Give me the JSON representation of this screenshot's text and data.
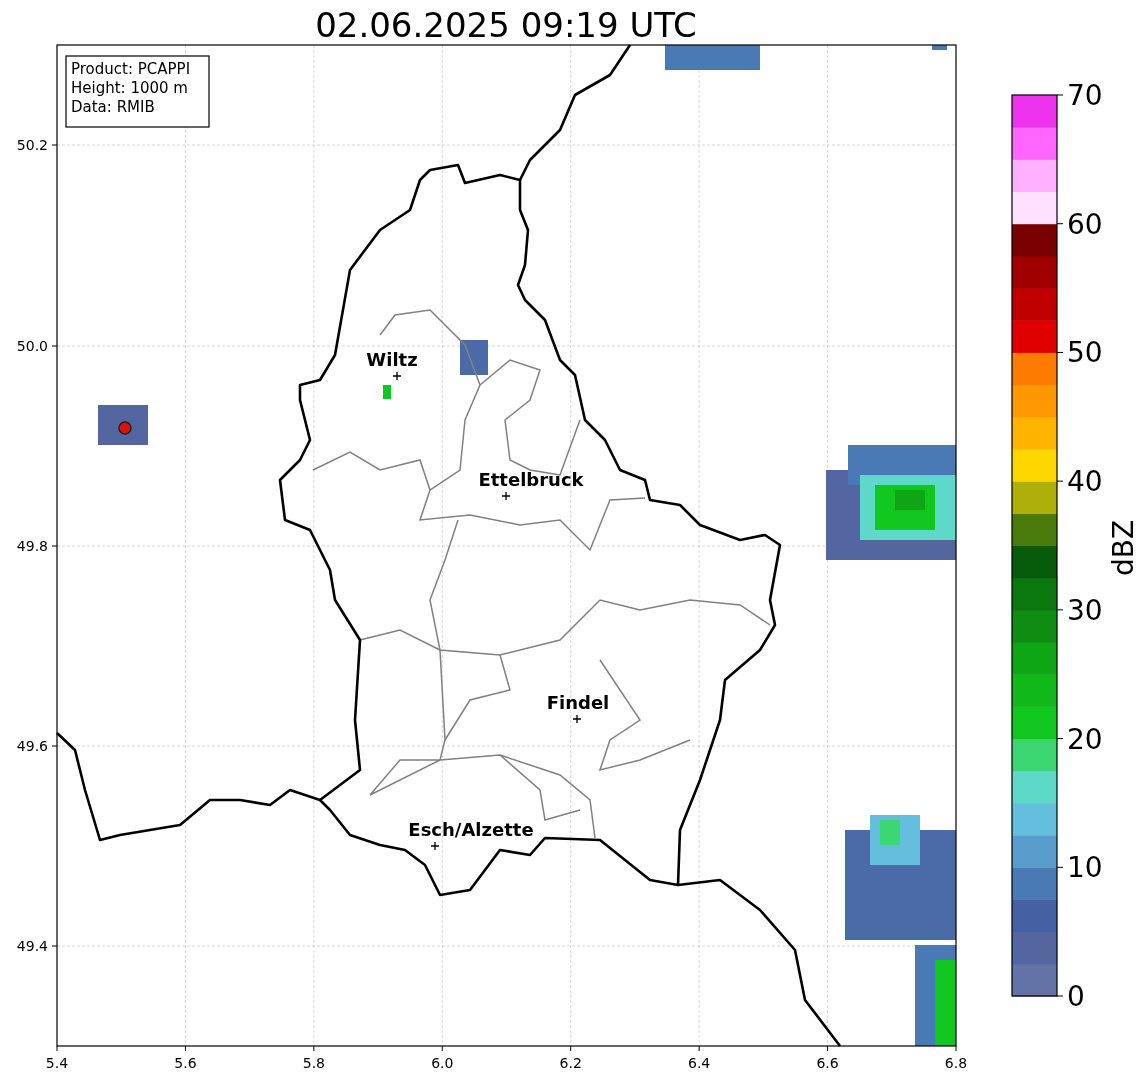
{
  "title": "02.06.2025 09:19 UTC",
  "info_box": [
    "Product: PCAPPI",
    "Height: 1000 m",
    "Data: RMIB"
  ],
  "cities": [
    {
      "name": "Wiltz"
    },
    {
      "name": "Ettelbruck"
    },
    {
      "name": "Findel"
    },
    {
      "name": "Esch/Alzette"
    }
  ],
  "x_axis": {
    "ticks": [
      "5.4",
      "5.6",
      "5.8",
      "6.0",
      "6.2",
      "6.4",
      "6.6",
      "6.8"
    ]
  },
  "y_axis": {
    "ticks": [
      "50.2",
      "50.0",
      "49.8",
      "49.6",
      "49.4"
    ]
  },
  "colorbar": {
    "label": "dBZ",
    "ticks": [
      "70",
      "60",
      "50",
      "40",
      "30",
      "20",
      "10",
      "0"
    ],
    "bins": [
      {
        "color": "#6373a8"
      },
      {
        "color": "#5466a0"
      },
      {
        "color": "#4560a3"
      },
      {
        "color": "#4a7ab5"
      },
      {
        "color": "#589dcb"
      },
      {
        "color": "#64bfde"
      },
      {
        "color": "#5ed8c8"
      },
      {
        "color": "#3cd673"
      },
      {
        "color": "#12c620"
      },
      {
        "color": "#10b81a"
      },
      {
        "color": "#0fa615"
      },
      {
        "color": "#0e8d12"
      },
      {
        "color": "#0a780e"
      },
      {
        "color": "#065c0a"
      },
      {
        "color": "#4a7a0c"
      },
      {
        "color": "#aeb00a"
      },
      {
        "color": "#ffd700"
      },
      {
        "color": "#ffb400"
      },
      {
        "color": "#ff9800"
      },
      {
        "color": "#ff7b00"
      },
      {
        "color": "#e00000"
      },
      {
        "color": "#c00000"
      },
      {
        "color": "#a00000"
      },
      {
        "color": "#780000"
      },
      {
        "color": "#ffe0ff"
      },
      {
        "color": "#ffb0ff"
      },
      {
        "color": "#ff66ff"
      },
      {
        "color": "#ee33ee"
      }
    ]
  }
}
